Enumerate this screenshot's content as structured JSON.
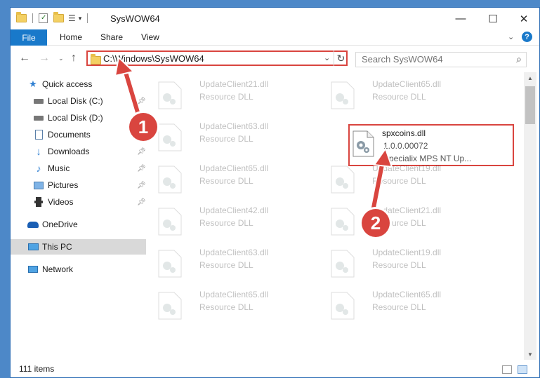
{
  "window": {
    "title": "SysWOW64",
    "controls": {
      "minimize": "—",
      "maximize": "☐",
      "close": "✕"
    }
  },
  "ribbon": {
    "tabs": [
      "File",
      "Home",
      "Share",
      "View"
    ],
    "expand_icon": "chevron-down-icon",
    "help_icon": "help-icon"
  },
  "address_bar": {
    "path": "C:\\Windows\\SysWOW64",
    "search_placeholder": "Search SysWOW64"
  },
  "nav": {
    "items": [
      {
        "label": "Quick access",
        "icon": "star-icon"
      },
      {
        "label": "Local Disk (C:)",
        "icon": "drive-icon"
      },
      {
        "label": "Local Disk (D:)",
        "icon": "drive-icon"
      },
      {
        "label": "Documents",
        "icon": "documents-icon"
      },
      {
        "label": "Downloads",
        "icon": "download-icon"
      },
      {
        "label": "Music",
        "icon": "music-icon"
      },
      {
        "label": "Pictures",
        "icon": "pictures-icon"
      },
      {
        "label": "Videos",
        "icon": "videos-icon"
      },
      {
        "label": "OneDrive",
        "icon": "cloud-icon"
      },
      {
        "label": "This PC",
        "icon": "computer-icon"
      },
      {
        "label": "Network",
        "icon": "network-icon"
      }
    ]
  },
  "files": {
    "left": [
      {
        "name": "UpdateClient21.dll",
        "type": "Resource DLL"
      },
      {
        "name": "UpdateClient63.dll",
        "type": "Resource DLL"
      },
      {
        "name": "UpdateClient65.dll",
        "type": "Resource DLL"
      },
      {
        "name": "UpdateClient42.dll",
        "type": "Resource DLL"
      },
      {
        "name": "UpdateClient63.dll",
        "type": "Resource DLL"
      },
      {
        "name": "UpdateClient65.dll",
        "type": "Resource DLL"
      }
    ],
    "right": [
      {
        "name": "UpdateClient65.dll",
        "type": "Resource DLL"
      },
      {
        "name": "UpdateClient19.dll",
        "type": "Resource DLL"
      },
      {
        "name": "UpdateClient21.dll",
        "type": "Resource DLL"
      },
      {
        "name": "UpdateClient19.dll",
        "type": "Resource DLL"
      },
      {
        "name": "UpdateClient65.dll",
        "type": "Resource DLL"
      }
    ],
    "highlighted": {
      "name": "spxcoins.dll",
      "version": "1.0.0.00072",
      "description": "Specialix MPS NT Up..."
    }
  },
  "status": {
    "count": "111 items"
  },
  "annotations": {
    "step1": "1",
    "step2": "2",
    "color": "#d9453f"
  }
}
